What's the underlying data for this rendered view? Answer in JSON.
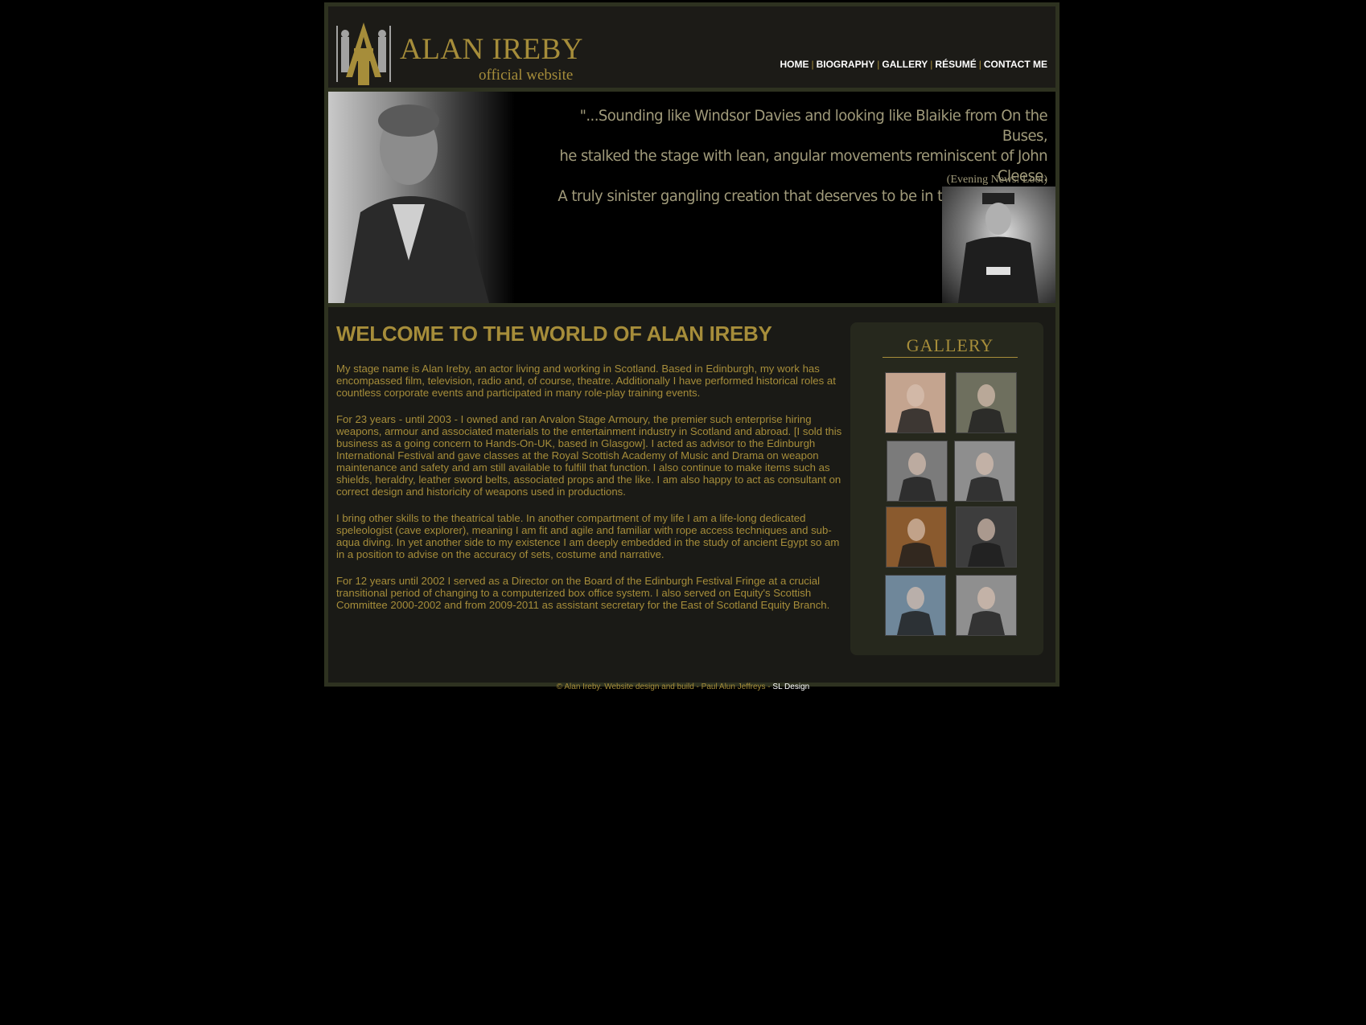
{
  "header": {
    "logo_title": "ALAN IREBY",
    "logo_subtitle": "official website",
    "nav": [
      {
        "label": "HOME"
      },
      {
        "label": "BIOGRAPHY"
      },
      {
        "label": "GALLERY"
      },
      {
        "label": "RÉSUMÉ"
      },
      {
        "label": "CONTACT ME"
      }
    ],
    "nav_separator": "|"
  },
  "banner": {
    "quote_lines": [
      "\"...Sounding like Windsor Davies and looking like Blaikie from On the Buses,",
      "he stalked the stage with lean, angular movements reminiscent of John Cleese.",
      "A truly sinister gangling creation that deserves to be in the comedy hall of fame.\""
    ],
    "quote_source": "(Evening News: Loot)"
  },
  "main": {
    "heading": "WELCOME TO THE WORLD OF ALAN IREBY",
    "paragraphs": [
      "My stage name is Alan Ireby, an actor living and working in Scotland. Based in Edinburgh, my work has encompassed film, television, radio and, of course, theatre. Additionally I have performed historical roles at countless corporate events and participated in many role-play training events.",
      "For 23 years - until 2003 - I owned and ran Arvalon Stage Armoury, the premier such enterprise hiring weapons, armour and associated materials to the entertainment industry in Scotland and abroad. [I sold this business as a going concern to Hands-On-UK, based in Glasgow]. I acted as advisor to the Edinburgh International Festival and gave classes at the Royal Scottish Academy of Music and Drama on weapon maintenance and safety and am still available to fulfill that function. I also continue to make items such as shields, heraldry, leather sword belts, associated props and the like. I am also happy to act as consultant on correct design and historicity of weapons used in productions.",
      "I bring other skills to the theatrical table. In another compartment of my life I am a life-long dedicated speleologist (cave explorer), meaning I am fit and agile and familiar with rope access techniques and sub-aqua diving. In yet another side to my existence I am deeply embedded in the study of ancient Egypt so am in a position to advise on the accuracy of sets, costume and narrative.",
      "For 12 years until 2002 I served as a Director on the Board of the Edinburgh Festival Fringe at a crucial transitional period of changing to a computerized box office system. I also served on Equity's Scottish Committee 2000-2002 and from 2009-2011 as assistant secretary for the East of Scotland Equity Branch."
    ]
  },
  "gallery": {
    "title": "GALLERY",
    "thumbnails": [
      {
        "tone": "#c4a48f"
      },
      {
        "tone": "#6e6f5e"
      },
      {
        "tone": "#7b7b7b"
      },
      {
        "tone": "#8e8e8e"
      },
      {
        "tone": "#8a5a2e"
      },
      {
        "tone": "#3d3d3d"
      },
      {
        "tone": "#6f879a"
      },
      {
        "tone": "#8f8f8f"
      }
    ]
  },
  "footer": {
    "text": "© Alan Ireby. Website design and build - Paul Alun Jeffreys - ",
    "link": "SL Design"
  },
  "colors": {
    "gold": "#a68d3a",
    "frame": "#2e3220",
    "background": "#000000",
    "panel": "#1a1a16"
  }
}
